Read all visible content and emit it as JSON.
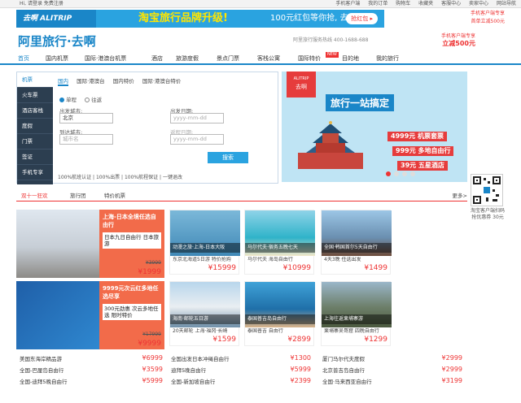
{
  "topbar": {
    "left": "Hi, 请登录 免费注册",
    "right": [
      "手机客户端",
      "我的订单",
      "购物车",
      "收藏夹",
      "客服中心",
      "卖家中心",
      "网站导航"
    ]
  },
  "ad": {
    "logo": "去啊 ALITRIP",
    "main": "淘宝旅行品牌升级!",
    "sub": "100元红包等你抢, 去啊!",
    "button": "抢红包 ▸",
    "right_a": "手机客户端专享",
    "right_b": "首单立减500元"
  },
  "header": {
    "brand": "阿里旅行·去啊",
    "hotline": "阿里旅行服务热线 400-1688-688",
    "app_line1": "手机客户端专享",
    "app_line2": "立减500元"
  },
  "nav": {
    "items": [
      "首页",
      "国内机票",
      "国际·港澳台机票",
      "酒店",
      "旅游度假",
      "景点门票",
      "客栈公寓",
      "国际特价",
      "目的地",
      "我的旅行"
    ],
    "new_badge": "NEW"
  },
  "search": {
    "side_tabs": [
      "机票",
      "火车票",
      "酒店客栈",
      "度假",
      "门票",
      "签证",
      "手机专享"
    ],
    "sub_tabs": [
      "国内",
      "国际·港澳台",
      "国内特价",
      "国际·港澳台特价"
    ],
    "oneway": "单程",
    "round": "往返",
    "from_label": "出发城市:",
    "from_value": "北京",
    "to_label": "到达城市:",
    "to_placeholder": "城市名",
    "depart_label": "出发日期:",
    "depart_placeholder": "yyyy-mm-dd",
    "return_label": "返程日期:",
    "return_placeholder": "yyyy-mm-dd",
    "button": "搜索",
    "guarantee": "100%航班认证 | 100%出票 | 100%航程保证 | 一键退改"
  },
  "banner": {
    "tag": "去啊",
    "tag_top": "ALITRIP",
    "slogan": "旅行一站搞定",
    "p1": "4999元 机票套票",
    "p2": "999元 多地自由行",
    "p3": "39元 五星酒店"
  },
  "qr": {
    "text": "淘宝客户端扫码 抢优惠券 30元"
  },
  "section_tabs": [
    "双十一狂欢",
    "旅行团",
    "特价机票"
  ],
  "section_more": "更多>",
  "big_cards": [
    {
      "headline": "上海-日本全境任选自由行",
      "desc": "日本九日自由行 日本旅游",
      "old_price": "¥3999",
      "price": "¥1999"
    },
    {
      "headline": "9999元次云红多地任选尽享",
      "desc": "300元劲惠 次云多地任选 限时特价",
      "old_price": "¥17999",
      "price": "¥9999"
    }
  ],
  "cards_row1": [
    {
      "cap": "动漫之旅·上海-日本大阪",
      "title": "东京北海道5日游 特价抢购",
      "price": "¥15999"
    },
    {
      "cap": "马尔代夫·宿务五晚七天",
      "title": "马尔代夫 海岛自由行",
      "price": "¥10999"
    },
    {
      "cap": "全国·韩国首尔5天自由行",
      "title": "4天3晚 任选出发",
      "price": "¥1499"
    }
  ],
  "cards_row2": [
    {
      "cap": "海南·邮轮五日游",
      "title": "20天邮轮 上海·福冈·长崎",
      "price": "¥1599"
    },
    {
      "cap": "泰国普吉岛自由行",
      "title": "泰国普吉 自由行",
      "price": "¥2899"
    },
    {
      "cap": "上海往返柬埔寨游",
      "title": "柬埔寨吴哥窟 四晚自由行",
      "price": "¥1299"
    }
  ],
  "list_left": [
    {
      "t": "美国东海岸精品游",
      "p": "¥6999"
    },
    {
      "t": "全国-巴厘岛自由行",
      "p": "¥3599"
    },
    {
      "t": "全国-迪拜5晚自由行",
      "p": "¥5999"
    }
  ],
  "list_mid": [
    {
      "t": "全国出发日本冲绳自由行",
      "p": "¥1300"
    },
    {
      "t": "迪拜5晚自由行",
      "p": "¥5999"
    },
    {
      "t": "全国-新加坡自由行",
      "p": "¥2399"
    }
  ],
  "list_right": [
    {
      "t": "厦门马尔代夫度假",
      "p": "¥2999"
    },
    {
      "t": "北京普吉岛自由行",
      "p": "¥2999"
    },
    {
      "t": "全国·马来西亚自由行",
      "p": "¥3199"
    }
  ],
  "colors": {
    "brand_blue": "#1a86c8",
    "accent_red": "#e33333",
    "orange": "#f26b4a"
  }
}
